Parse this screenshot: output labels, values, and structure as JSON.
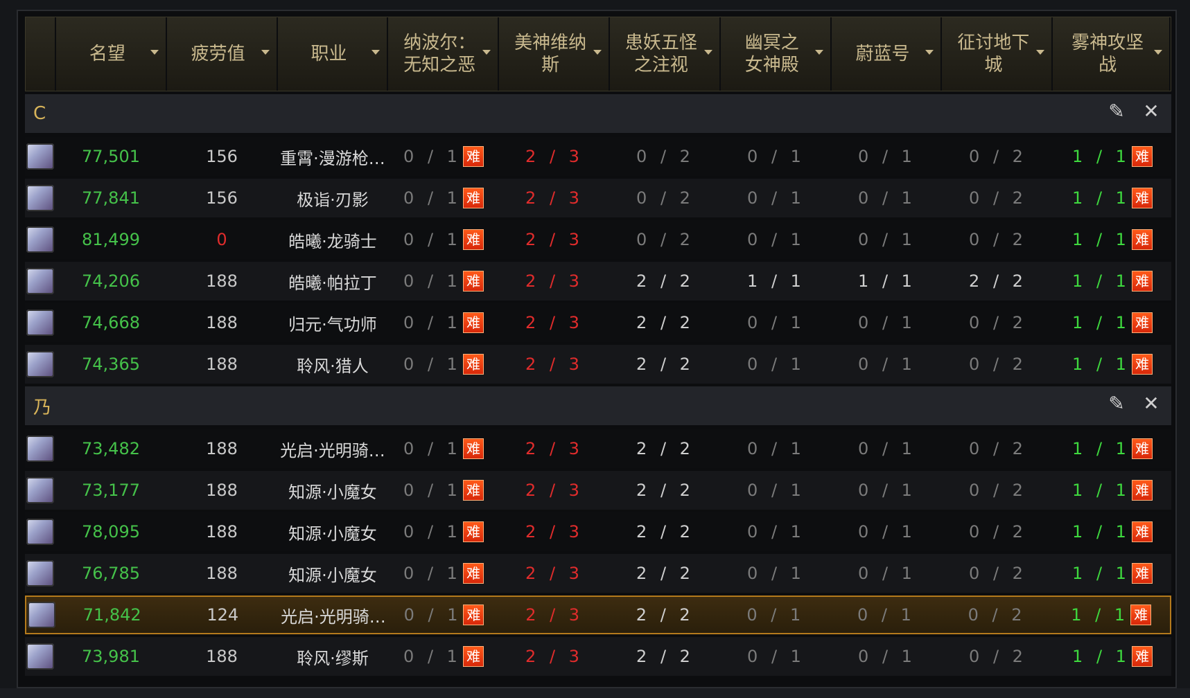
{
  "header": {
    "columns": [
      {
        "label": ""
      },
      {
        "label": "名望"
      },
      {
        "label": "疲劳值"
      },
      {
        "label": "职业"
      },
      {
        "label": "纳波尔：\n无知之恶"
      },
      {
        "label": "美神维纳\n斯"
      },
      {
        "label": "患妖五怪\n之注视"
      },
      {
        "label": "幽冥之\n女神殿"
      },
      {
        "label": "蔚蓝号"
      },
      {
        "label": "征讨地下\n城"
      },
      {
        "label": "雾神攻坚\n战"
      }
    ]
  },
  "badge_text": "难",
  "groups": [
    {
      "name": "C",
      "rows": [
        {
          "rep": "77,501",
          "fatigue": "156",
          "job": "重霄·漫游枪…",
          "c1": "0 / 1",
          "c2": "2 / 3",
          "c3": "0 / 2",
          "c4": "0 / 1",
          "c5": "0 / 1",
          "c6": "0 / 2",
          "c7": "1 / 1"
        },
        {
          "rep": "77,841",
          "fatigue": "156",
          "job": "极诣·刃影",
          "c1": "0 / 1",
          "c2": "2 / 3",
          "c3": "0 / 2",
          "c4": "0 / 1",
          "c5": "0 / 1",
          "c6": "0 / 2",
          "c7": "1 / 1"
        },
        {
          "rep": "81,499",
          "fatigue": "0",
          "job": "皓曦·龙骑士",
          "c1": "0 / 1",
          "c2": "2 / 3",
          "c3": "0 / 2",
          "c4": "0 / 1",
          "c5": "0 / 1",
          "c6": "0 / 2",
          "c7": "1 / 1"
        },
        {
          "rep": "74,206",
          "fatigue": "188",
          "job": "皓曦·帕拉丁",
          "c1": "0 / 1",
          "c2": "2 / 3",
          "c3": "2 / 2",
          "c4": "1 / 1",
          "c5": "1 / 1",
          "c6": "2 / 2",
          "c7": "1 / 1"
        },
        {
          "rep": "74,668",
          "fatigue": "188",
          "job": "归元·气功师",
          "c1": "0 / 1",
          "c2": "2 / 3",
          "c3": "2 / 2",
          "c4": "0 / 1",
          "c5": "0 / 1",
          "c6": "0 / 2",
          "c7": "1 / 1"
        },
        {
          "rep": "74,365",
          "fatigue": "188",
          "job": "聆风·猎人",
          "c1": "0 / 1",
          "c2": "2 / 3",
          "c3": "2 / 2",
          "c4": "0 / 1",
          "c5": "0 / 1",
          "c6": "0 / 2",
          "c7": "1 / 1"
        }
      ]
    },
    {
      "name": "乃",
      "rows": [
        {
          "rep": "73,482",
          "fatigue": "188",
          "job": "光启·光明骑…",
          "c1": "0 / 1",
          "c2": "2 / 3",
          "c3": "2 / 2",
          "c4": "0 / 1",
          "c5": "0 / 1",
          "c6": "0 / 2",
          "c7": "1 / 1"
        },
        {
          "rep": "73,177",
          "fatigue": "188",
          "job": "知源·小魔女",
          "c1": "0 / 1",
          "c2": "2 / 3",
          "c3": "2 / 2",
          "c4": "0 / 1",
          "c5": "0 / 1",
          "c6": "0 / 2",
          "c7": "1 / 1"
        },
        {
          "rep": "78,095",
          "fatigue": "188",
          "job": "知源·小魔女",
          "c1": "0 / 1",
          "c2": "2 / 3",
          "c3": "2 / 2",
          "c4": "0 / 1",
          "c5": "0 / 1",
          "c6": "0 / 2",
          "c7": "1 / 1"
        },
        {
          "rep": "76,785",
          "fatigue": "188",
          "job": "知源·小魔女",
          "c1": "0 / 1",
          "c2": "2 / 3",
          "c3": "2 / 2",
          "c4": "0 / 1",
          "c5": "0 / 1",
          "c6": "0 / 2",
          "c7": "1 / 1"
        },
        {
          "rep": "71,842",
          "fatigue": "124",
          "job": "光启·光明骑…",
          "c1": "0 / 1",
          "c2": "2 / 3",
          "c3": "2 / 2",
          "c4": "0 / 1",
          "c5": "0 / 1",
          "c6": "0 / 2",
          "c7": "1 / 1",
          "selected": true
        },
        {
          "rep": "73,981",
          "fatigue": "188",
          "job": "聆风·缪斯",
          "c1": "0 / 1",
          "c2": "2 / 3",
          "c3": "2 / 2",
          "c4": "0 / 1",
          "c5": "0 / 1",
          "c6": "0 / 2",
          "c7": "1 / 1"
        }
      ]
    }
  ],
  "icons": {
    "edit": "pencil-icon",
    "close": "close-icon",
    "sort": "chevron-down-icon"
  },
  "colors": {
    "reputation": "#45c24a",
    "zero_fatigue": "#e02c2c",
    "badge": "#e0401a",
    "group_label": "#d8b45a",
    "selected_border": "#b47a1c"
  }
}
